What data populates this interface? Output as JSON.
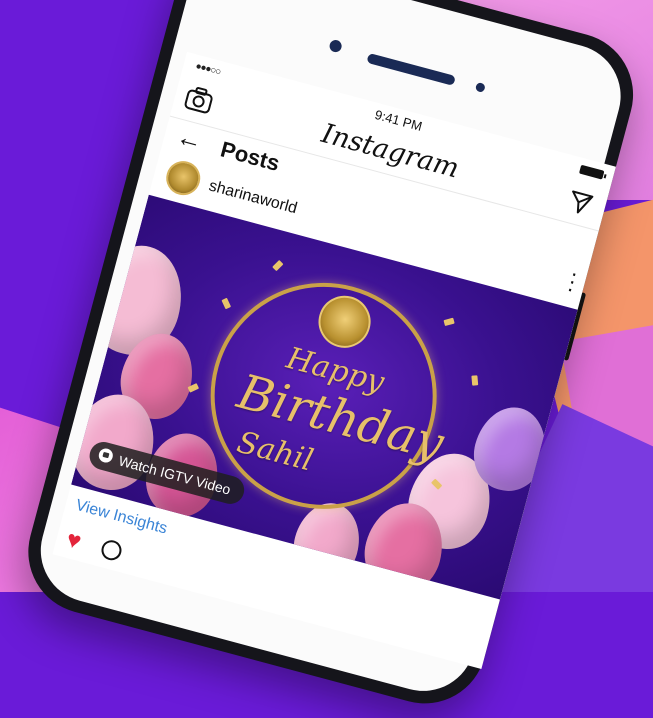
{
  "status_bar": {
    "time": "9:41 PM"
  },
  "app": {
    "logo": "Instagram"
  },
  "screen": {
    "title": "Posts"
  },
  "post": {
    "username": "sharinaworld",
    "image": {
      "happy": "Happy",
      "birthday": "Birthday",
      "name": "Sahil"
    },
    "igtv_label": "Watch IGTV Video",
    "insights_label": "View Insights"
  },
  "icons": {
    "camera": "camera-icon",
    "send": "send-icon",
    "back": "back-arrow-icon",
    "more": "more-options-icon",
    "heart": "heart-icon",
    "comment": "comment-icon"
  },
  "colors": {
    "background": "#6a1bd8",
    "post_background": "#3a1190",
    "gold": "#caa148",
    "link_blue": "#3a84d6",
    "heart_red": "#e3243b"
  }
}
